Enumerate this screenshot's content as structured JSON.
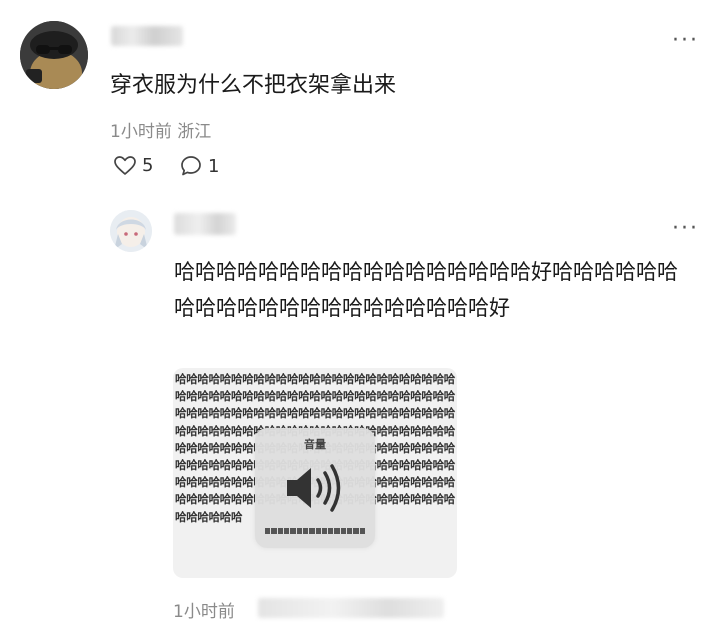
{
  "comment": {
    "text": "穿衣服为什么不把衣架拿出来",
    "meta": "1小时前  浙江",
    "likes": "5",
    "replies": "1",
    "more": "···"
  },
  "reply": {
    "text": "哈哈哈哈哈哈哈哈哈哈哈哈哈哈哈哈哈好哈哈哈哈哈哈哈哈哈哈哈哈哈哈哈哈哈哈哈哈哈好",
    "more": "···",
    "image": {
      "background_text": "哈哈哈哈哈哈哈哈哈哈哈哈哈哈哈哈哈哈哈哈哈哈哈哈哈哈哈哈哈哈哈哈哈哈哈哈哈哈哈哈哈哈哈哈哈哈哈哈哈哈哈哈哈哈哈哈哈哈哈哈哈哈哈哈哈哈哈哈哈哈哈哈哈哈哈哈哈哈哈哈哈哈哈哈哈哈哈哈哈哈哈哈哈哈哈哈哈哈哈哈哈哈哈哈哈哈哈哈哈哈哈哈哈哈哈哈哈哈哈哈哈哈哈哈哈哈哈哈哈哈哈哈哈哈哈哈哈哈哈哈哈哈哈哈哈哈哈哈哈哈哈哈哈哈哈哈哈哈哈哈哈哈哈哈哈哈哈哈哈哈哈哈哈哈哈哈哈哈哈哈哈哈哈哈哈哈哈哈哈哈哈哈哈哈哈哈哈哈哈哈哈哈哈哈哈哈",
      "volume_title": "音量",
      "volume_level": 1.0
    },
    "meta": "1小时前"
  }
}
